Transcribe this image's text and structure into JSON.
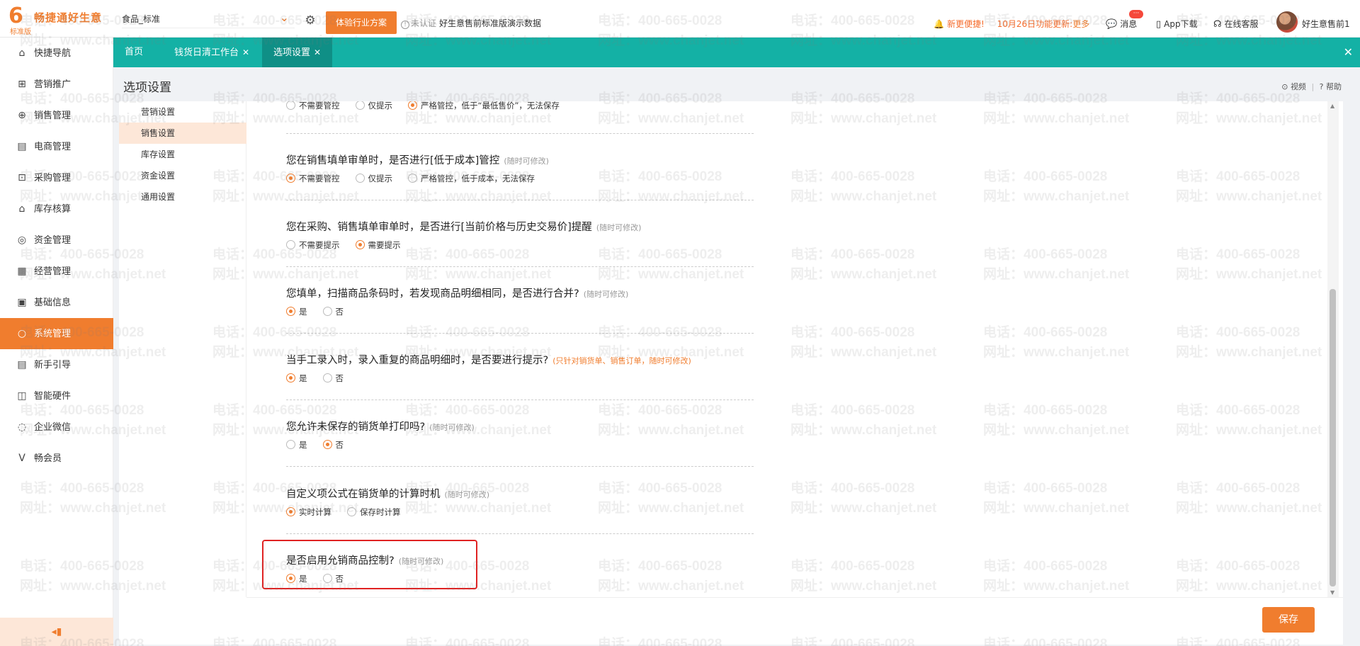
{
  "logo": {
    "name": "畅捷通好生意",
    "edition": "标准版"
  },
  "header": {
    "company_select": "食品_标准",
    "trial_button": "体验行业方案",
    "cert_status": "未认证",
    "demo_name": "好生意售前标准版演示数据",
    "notice_prefix": "新更便捷!",
    "notice_text": "10月26日功能更新:",
    "notice_more": "更多",
    "nav": [
      {
        "label": "消息",
        "icon": "chat-icon"
      },
      {
        "label": "App下载",
        "icon": "phone-icon"
      },
      {
        "label": "在线客服",
        "icon": "headset-icon"
      }
    ],
    "message_badge": "···",
    "user_name": "好生意售前1"
  },
  "sidebar": {
    "items": [
      {
        "label": "快捷导航",
        "icon": "home-icon",
        "glyph": "⌂"
      },
      {
        "label": "营销推广",
        "icon": "gift-icon",
        "glyph": "⊞"
      },
      {
        "label": "销售管理",
        "icon": "sales-icon",
        "glyph": "⊕"
      },
      {
        "label": "电商管理",
        "icon": "shop-icon",
        "glyph": "▤"
      },
      {
        "label": "采购管理",
        "icon": "purchase-icon",
        "glyph": "⊡"
      },
      {
        "label": "库存核算",
        "icon": "warehouse-icon",
        "glyph": "⌂"
      },
      {
        "label": "资金管理",
        "icon": "money-icon",
        "glyph": "◎"
      },
      {
        "label": "经营管理",
        "icon": "report-icon",
        "glyph": "▦"
      },
      {
        "label": "基础信息",
        "icon": "info-icon",
        "glyph": "▣"
      },
      {
        "label": "系统管理",
        "icon": "system-icon",
        "glyph": "○"
      },
      {
        "label": "新手引导",
        "icon": "guide-icon",
        "glyph": "▤"
      },
      {
        "label": "智能硬件",
        "icon": "hardware-icon",
        "glyph": "◫"
      },
      {
        "label": "企业微信",
        "icon": "wecom-icon",
        "glyph": "◌"
      },
      {
        "label": "畅会员",
        "icon": "vip-icon",
        "glyph": "V"
      }
    ],
    "active_index": 9,
    "collapse_glyph": "◂▮"
  },
  "tabs": [
    {
      "label": "首页",
      "closable": false
    },
    {
      "label": "钱货日清工作台",
      "closable": true
    },
    {
      "label": "选项设置",
      "closable": true,
      "active": true
    }
  ],
  "page": {
    "title": "选项设置",
    "video_link": "视频",
    "help_link": "帮助"
  },
  "categories": [
    "营销设置",
    "销售设置",
    "库存设置",
    "资金设置",
    "通用设置"
  ],
  "active_category": 1,
  "settings": [
    {
      "question": "",
      "tip": "",
      "options": [
        "不需要管控",
        "仅提示",
        "严格管控，低于“最低售价”，无法保存"
      ],
      "selected": 2
    },
    {
      "question": "您在销售填单审单时，是否进行[低于成本]管控",
      "tip": "(随时可修改)",
      "options": [
        "不需要管控",
        "仅提示",
        "严格管控，低于成本，无法保存"
      ],
      "selected": 0
    },
    {
      "question": "您在采购、销售填单审单时，是否进行[当前价格与历史交易价]提醒",
      "tip": "(随时可修改)",
      "options": [
        "不需要提示",
        "需要提示"
      ],
      "selected": 1
    },
    {
      "question": "您填单，扫描商品条码时，若发现商品明细相同，是否进行合并?",
      "tip": "(随时可修改)",
      "options": [
        "是",
        "否"
      ],
      "selected": 0
    },
    {
      "question": "当手工录入时，录入重复的商品明细时，是否要进行提示?",
      "tip": "(只针对销货单、销售订单，随时可修改)",
      "tip_color": "orange",
      "options": [
        "是",
        "否"
      ],
      "selected": 0
    },
    {
      "question": "您允许未保存的销货单打印吗?",
      "tip": "(随时可修改)",
      "options": [
        "是",
        "否"
      ],
      "selected": 1
    },
    {
      "question": "自定义项公式在销货单的计算时机",
      "tip": "(随时可修改)",
      "options": [
        "实时计算",
        "保存时计算"
      ],
      "selected": 0
    },
    {
      "question": "是否启用允销商品控制?",
      "tip": "(随时可修改)",
      "options": [
        "是",
        "否"
      ],
      "selected": 0
    }
  ],
  "save_button": "保存",
  "watermark": {
    "phone": "电话：400-665-0028",
    "site": "网址：www.chanjet.net"
  }
}
